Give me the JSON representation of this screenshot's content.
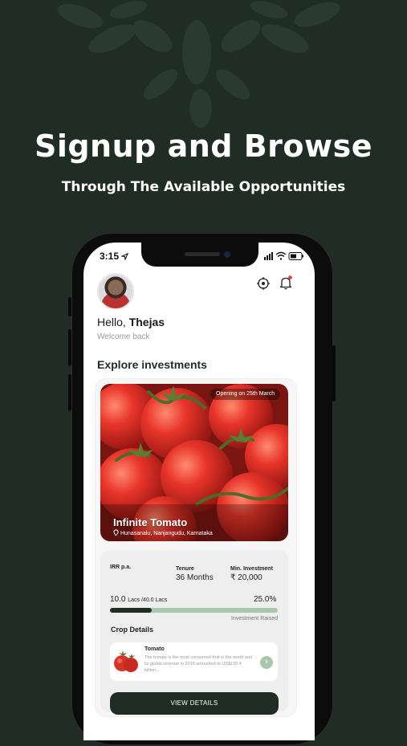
{
  "hero": {
    "title": "Signup and Browse",
    "subtitle": "Through The Available Opportunities"
  },
  "status_bar": {
    "time": "3:15"
  },
  "header": {
    "greeting": "Hello,",
    "user_name": "Thejas",
    "welcome": "Welcome back"
  },
  "section": {
    "title": "Explore investments"
  },
  "opportunity": {
    "badge": "Opening on 25th March",
    "name": "Infinite Tomato",
    "location": "Hunasanalu, Nanjangudu, Karnataka",
    "irr_label": "IRR p.a.",
    "irr_value": "",
    "tenure_label": "Tenure",
    "tenure_value": "36 Months",
    "min_label": "Min. Investment",
    "min_value": "₹ 20,000",
    "raised_amount": "10.0",
    "raised_unit": "Lacs /40.0 Lacs",
    "raised_percent": "25.0%",
    "raised_fraction": 0.25,
    "raised_label": "Investment Raised",
    "crop_section": "Crop Details",
    "crop_name": "Tomato",
    "crop_desc": "The tomato is the most consumed fruit in the world and its global revenue in 2018 amounted to US$190.4 billion...",
    "cta": "VIEW DETAILS"
  },
  "colors": {
    "brand_dark": "#1f2d25",
    "accent_light": "#a8c7ae",
    "notification_dot": "#e23a3a"
  },
  "icons": [
    "navigation-arrow-icon",
    "signal-icon",
    "wifi-icon",
    "battery-icon",
    "target-icon",
    "bell-icon",
    "location-pin-icon",
    "chevron-right-icon"
  ]
}
